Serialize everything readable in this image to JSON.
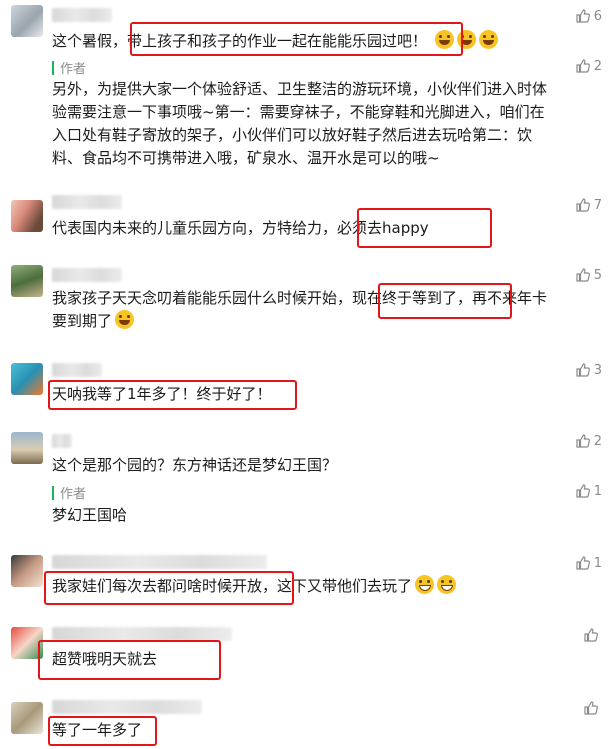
{
  "comments": [
    {
      "text_line1": "这个暑假，带上孩子和孩子的作业一起在能能乐园过吧！",
      "likes": "6",
      "author_label": "作者",
      "reply_lines": [
        "另外，为提供大家一个体验舒适、卫生整洁的游玩环境，小伙伴们进入时体",
        "验需要注意一下事项哦~第一：需要穿袜子，不能穿鞋和光脚进入，咱们在",
        "入口处有鞋子寄放的架子，小伙伴们可以放好鞋子然后进去玩哈第二：饮",
        "料、食品均不可携带进入哦，矿泉水、温开水是可以的哦~"
      ],
      "reply_likes": "2"
    },
    {
      "text": "代表国内未来的儿童乐园方向，方特给力，必须去happy",
      "likes": "7"
    },
    {
      "text_line1": "我家孩子天天念叨着能能乐园什么时候开始，现在终于等到了，再不来年卡",
      "text_line2": "要到期了",
      "likes": "5"
    },
    {
      "text": "天呐我等了1年多了！终于好了！",
      "likes": "3"
    },
    {
      "text": "这个是那个园的？东方神话还是梦幻王国？",
      "likes": "2",
      "author_label": "作者",
      "reply": "梦幻王国哈",
      "reply_likes": "1"
    },
    {
      "text": "我家娃们每次去都问啥时候开放，这下又带他们去玩了",
      "likes": "1"
    },
    {
      "text": "超赞哦明天就去",
      "likes": ""
    },
    {
      "text": "等了一年多了",
      "likes": ""
    }
  ],
  "colors": {
    "highlight_box": "#e2151a",
    "author_bar": "#19b75a",
    "muted": "#8a8a8a"
  },
  "icons": {
    "like": "thumbs-up-icon",
    "emoji": "laugh-emoji-icon"
  }
}
